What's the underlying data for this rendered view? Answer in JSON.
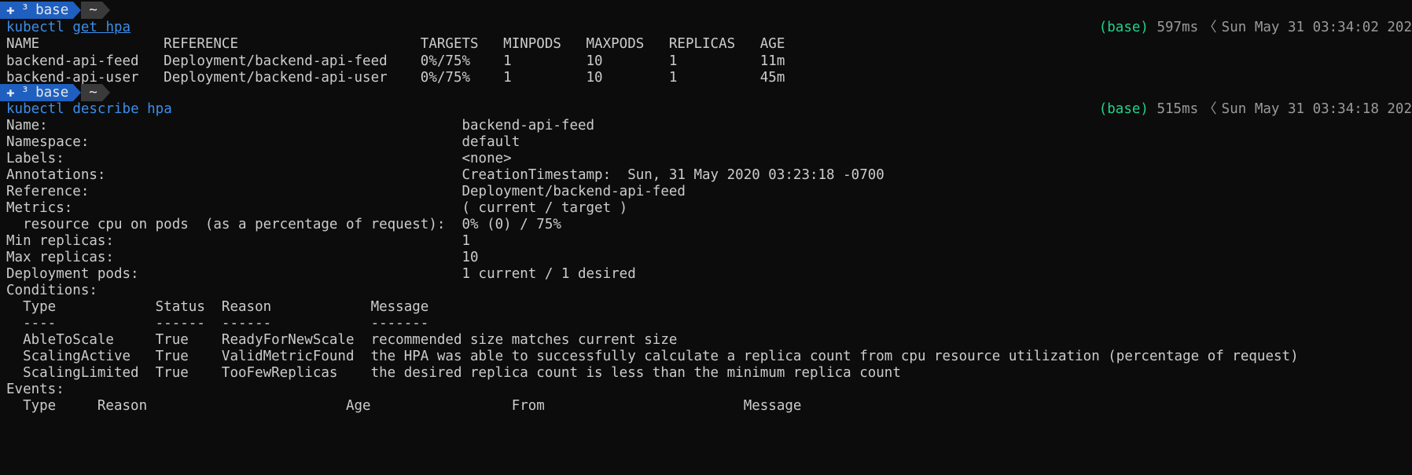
{
  "prompt": {
    "env": "base",
    "cwd": "~",
    "marker": "³"
  },
  "commands": [
    {
      "cmd": "kubectl",
      "args": "get hpa",
      "status_env": "(base)",
      "duration": "597ms",
      "datetime": "Sun May 31 03:34:02 202"
    },
    {
      "cmd": "kubectl",
      "args": "describe hpa",
      "status_env": "(base)",
      "duration": "515ms",
      "datetime": "Sun May 31 03:34:18 202"
    }
  ],
  "hpa_table": {
    "header": "NAME               REFERENCE                      TARGETS   MINPODS   MAXPODS   REPLICAS   AGE",
    "rows": [
      "backend-api-feed   Deployment/backend-api-feed    0%/75%    1         10        1          11m",
      "backend-api-user   Deployment/backend-api-user    0%/75%    1         10        1          45m"
    ]
  },
  "describe": {
    "lines": [
      "Name:                                                  backend-api-feed",
      "Namespace:                                             default",
      "Labels:                                                <none>",
      "Annotations:                                           CreationTimestamp:  Sun, 31 May 2020 03:23:18 -0700",
      "Reference:                                             Deployment/backend-api-feed",
      "Metrics:                                               ( current / target )",
      "  resource cpu on pods  (as a percentage of request):  0% (0) / 75%",
      "Min replicas:                                          1",
      "Max replicas:                                          10",
      "Deployment pods:                                       1 current / 1 desired",
      "Conditions:",
      "  Type            Status  Reason            Message",
      "  ----            ------  ------            -------",
      "  AbleToScale     True    ReadyForNewScale  recommended size matches current size",
      "  ScalingActive   True    ValidMetricFound  the HPA was able to successfully calculate a replica count from cpu resource utilization (percentage of request)",
      "  ScalingLimited  True    TooFewReplicas    the desired replica count is less than the minimum replica count",
      "Events:",
      "  Type     Reason                        Age                 From                        Message"
    ]
  }
}
